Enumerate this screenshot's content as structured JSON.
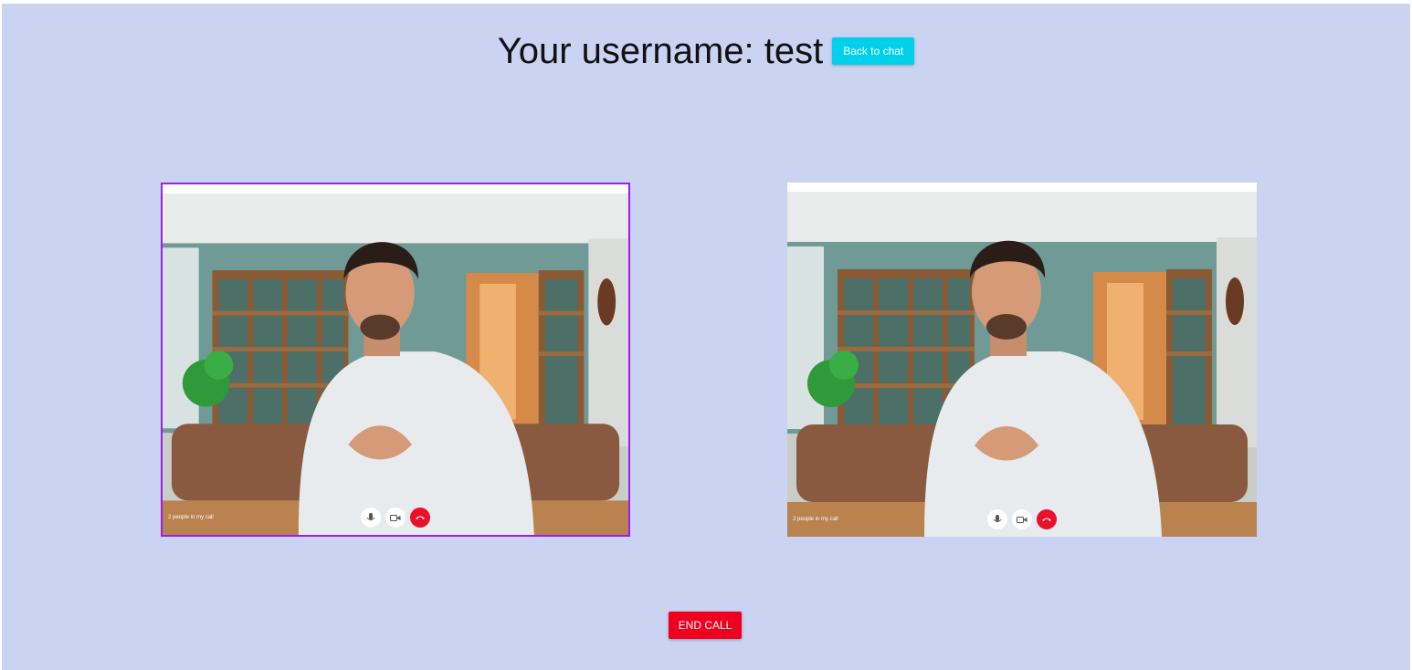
{
  "header": {
    "title": "Your username: test",
    "back_button_label": "Back to chat"
  },
  "videos": {
    "local": {
      "caption": "2 people in my call",
      "stream": "local-video-stream"
    },
    "remote": {
      "caption": "2 people in my call",
      "stream": "remote-video-stream"
    }
  },
  "call_controls": {
    "icons": [
      "mic-icon",
      "camera-icon",
      "hang-up-icon"
    ]
  },
  "end_call_label": "END CALL",
  "colors": {
    "background": "#cbd3f3",
    "back_button": "#00d1ea",
    "end_call": "#f00020",
    "local_border": "#9b1df0",
    "hang_up": "#e8102a"
  }
}
